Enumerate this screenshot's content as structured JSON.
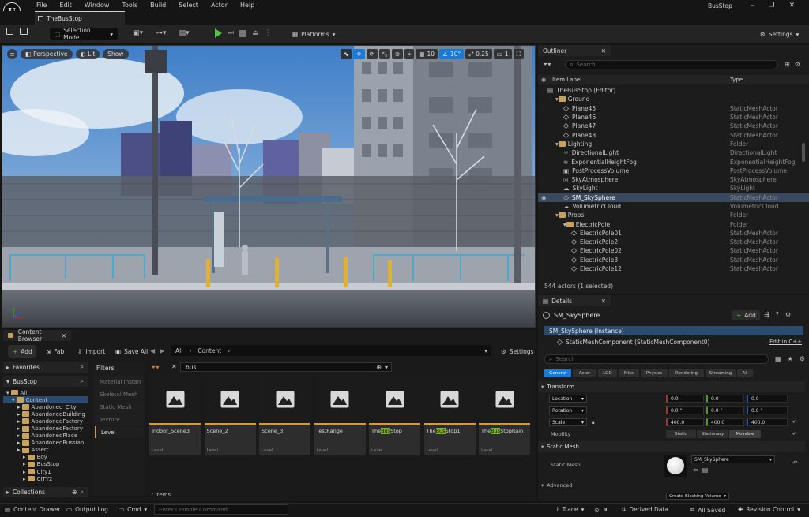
{
  "app": {
    "title": "BusStop",
    "doc_tab": "TheBusStop"
  },
  "menu": [
    "File",
    "Edit",
    "Window",
    "Tools",
    "Build",
    "Select",
    "Actor",
    "Help"
  ],
  "toolbar": {
    "selection_mode": "Selection Mode",
    "platforms": "Platforms",
    "settings": "Settings"
  },
  "viewport": {
    "perspective": "Perspective",
    "lit": "Lit",
    "show": "Show",
    "grid_snap": "10",
    "rot_snap": "10°",
    "scale_snap": "0.25",
    "cam_speed": "1"
  },
  "outliner": {
    "tab": "Outliner",
    "search_placeholder": "Search...",
    "col_label": "Item Label",
    "col_type": "Type",
    "rows": [
      {
        "label": "TheBusStop (Editor)",
        "type": "",
        "kind": "world",
        "indent": 0
      },
      {
        "label": "Ground",
        "type": "",
        "kind": "folder",
        "indent": 1
      },
      {
        "label": "Plane45",
        "type": "StaticMeshActor",
        "kind": "mesh",
        "indent": 2
      },
      {
        "label": "Plane46",
        "type": "StaticMeshActor",
        "kind": "mesh",
        "indent": 2
      },
      {
        "label": "Plane47",
        "type": "StaticMeshActor",
        "kind": "mesh",
        "indent": 2
      },
      {
        "label": "Plane48",
        "type": "StaticMeshActor",
        "kind": "mesh",
        "indent": 2
      },
      {
        "label": "Lighting",
        "type": "Folder",
        "kind": "folder",
        "indent": 1
      },
      {
        "label": "DirectionalLight",
        "type": "DirectionalLight",
        "kind": "light",
        "indent": 2
      },
      {
        "label": "ExponentialHeightFog",
        "type": "ExponentialHeightFog",
        "kind": "fog",
        "indent": 2
      },
      {
        "label": "PostProcessVolume",
        "type": "PostProcessVolume",
        "kind": "volume",
        "indent": 2
      },
      {
        "label": "SkyAtmosphere",
        "type": "SkyAtmosphere",
        "kind": "sky",
        "indent": 2
      },
      {
        "label": "SkyLight",
        "type": "SkyLight",
        "kind": "skylight",
        "indent": 2
      },
      {
        "label": "SM_SkySphere",
        "type": "StaticMeshActor",
        "kind": "mesh",
        "indent": 2,
        "selected": true
      },
      {
        "label": "VolumetricCloud",
        "type": "VolumetricCloud",
        "kind": "cloud",
        "indent": 2
      },
      {
        "label": "Props",
        "type": "Folder",
        "kind": "folder",
        "indent": 1
      },
      {
        "label": "ElectricPole",
        "type": "Folder",
        "kind": "folder",
        "indent": 2
      },
      {
        "label": "ElectricPole01",
        "type": "StaticMeshActor",
        "kind": "mesh",
        "indent": 3
      },
      {
        "label": "ElectricPole2",
        "type": "StaticMeshActor",
        "kind": "mesh",
        "indent": 3
      },
      {
        "label": "ElectricPole02",
        "type": "StaticMeshActor",
        "kind": "mesh",
        "indent": 3
      },
      {
        "label": "ElectricPole3",
        "type": "StaticMeshActor",
        "kind": "mesh",
        "indent": 3
      },
      {
        "label": "ElectricPole12",
        "type": "StaticMeshActor",
        "kind": "mesh",
        "indent": 3
      }
    ],
    "status": "544 actors (1 selected)"
  },
  "details": {
    "tab": "Details",
    "actor": "SM_SkySphere",
    "add": "Add",
    "instance": "SM_SkySphere (Instance)",
    "component": "StaticMeshComponent (StaticMeshComponent0)",
    "edit_cpp": "Edit in C++",
    "search_placeholder": "Search",
    "filters": [
      "General",
      "Actor",
      "LOD",
      "Misc",
      "Physics",
      "Rendering",
      "Streaming",
      "All"
    ],
    "transform_header": "Transform",
    "location_label": "Location",
    "location": [
      "0.0",
      "0.0",
      "0.0"
    ],
    "rotation_label": "Rotation",
    "rotation": [
      "0.0 °",
      "0.0 °",
      "0.0 °"
    ],
    "scale_label": "Scale",
    "scale": [
      "400.0",
      "400.0",
      "400.0"
    ],
    "mobility_label": "Mobility",
    "mobility": [
      "Static",
      "Stationary",
      "Movable"
    ],
    "static_mesh_header": "Static Mesh",
    "static_mesh_label": "Static Mesh",
    "static_mesh_value": "SM_SkySphere",
    "advanced": "Advanced",
    "blocking_volume": "Create Blocking Volume"
  },
  "content_browser": {
    "tab": "Content Browser",
    "add": "Add",
    "fab": "Fab",
    "import": "Import",
    "save_all": "Save All",
    "path": [
      "All",
      "Content"
    ],
    "settings": "Settings",
    "favorites": "Favorites",
    "root": "BusStop",
    "tree": [
      {
        "label": "All",
        "indent": 0
      },
      {
        "label": "Content",
        "indent": 1,
        "selected": true
      },
      {
        "label": "Abandoned_City",
        "indent": 2
      },
      {
        "label": "AbandonedBuilding",
        "indent": 2
      },
      {
        "label": "AbandonedFactory",
        "indent": 2
      },
      {
        "label": "AbandonedFactory",
        "indent": 2
      },
      {
        "label": "AbandonedPlace",
        "indent": 2
      },
      {
        "label": "AbandonedRussian",
        "indent": 2
      },
      {
        "label": "Assert",
        "indent": 2
      },
      {
        "label": "Boy",
        "indent": 3
      },
      {
        "label": "BusStop",
        "indent": 3
      },
      {
        "label": "City1",
        "indent": 3
      },
      {
        "label": "CITY2",
        "indent": 3
      }
    ],
    "filters_title": "Filters",
    "filters": [
      "Material Instan",
      "Skeletal Mesh",
      "Static Mesh",
      "Texture",
      "Level"
    ],
    "search_value": "bus",
    "items": [
      {
        "pre": "Indoor_Scene3",
        "hl": "",
        "post": "",
        "type": "Level"
      },
      {
        "pre": "Scene_2",
        "hl": "",
        "post": "",
        "type": "Level"
      },
      {
        "pre": "Scene_3",
        "hl": "",
        "post": "",
        "type": "Level"
      },
      {
        "pre": "TestRange",
        "hl": "",
        "post": "",
        "type": "Level"
      },
      {
        "pre": "The",
        "hl": "Bus",
        "post": "Stop",
        "type": "Level"
      },
      {
        "pre": "The",
        "hl": "Bus",
        "post": "Stop1",
        "type": "Level"
      },
      {
        "pre": "The",
        "hl": "Bus",
        "post": "StopRain",
        "type": "Level"
      }
    ],
    "count": "7 items",
    "collections": "Collections"
  },
  "statusbar": {
    "content_drawer": "Content Drawer",
    "output_log": "Output Log",
    "cmd": "Cmd",
    "console_placeholder": "Enter Console Command",
    "trace": "Trace",
    "derived_data": "Derived Data",
    "all_saved": "All Saved",
    "revision": "Revision Control"
  },
  "colors": {
    "accent": "#1a7bd6",
    "selection": "#3a4a5e",
    "folder": "#c9a15e",
    "level_bar": "#d89a2a",
    "highlight": "#7ab32a"
  }
}
